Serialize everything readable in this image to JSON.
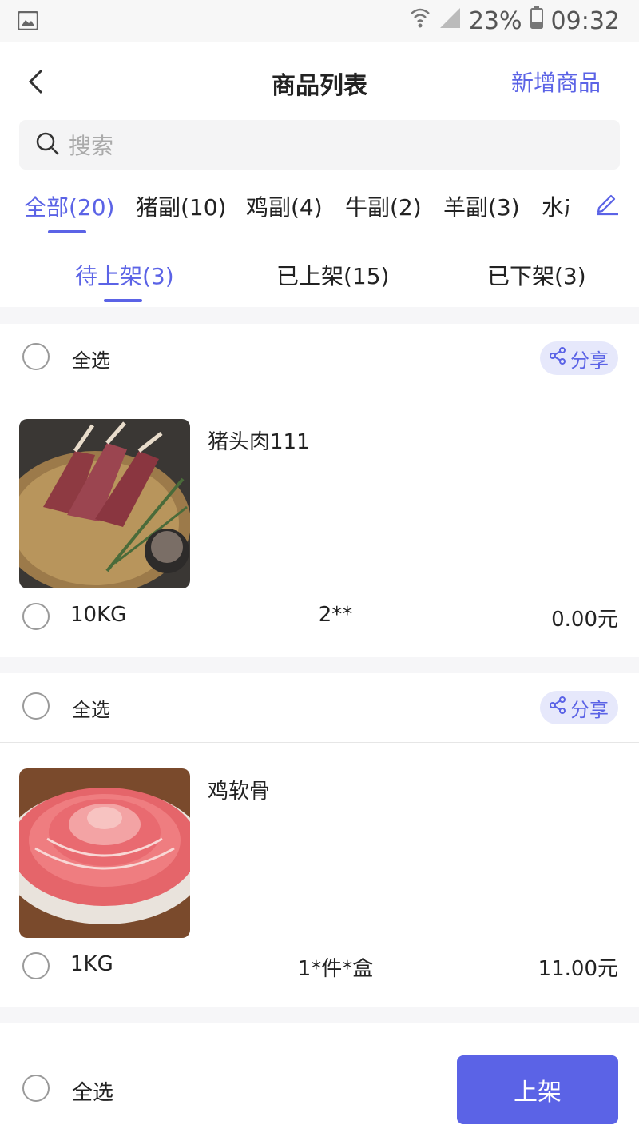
{
  "status_bar": {
    "battery": "23%",
    "time": "09:32"
  },
  "nav": {
    "title": "商品列表",
    "add_label": "新增商品"
  },
  "search": {
    "placeholder": "搜索"
  },
  "categories": [
    {
      "label": "全部(20)",
      "active": true
    },
    {
      "label": "猪副(10)"
    },
    {
      "label": "鸡副(4)"
    },
    {
      "label": "牛副(2)"
    },
    {
      "label": "羊副(3)"
    },
    {
      "label": "水产"
    }
  ],
  "status_tabs": [
    {
      "label": "待上架(3)",
      "active": true
    },
    {
      "label": "已上架(15)"
    },
    {
      "label": "已下架(3)"
    }
  ],
  "groups": [
    {
      "select_all_label": "全选",
      "share_label": "分享",
      "item": {
        "name": "猪头肉111",
        "weight": "10KG",
        "spec": "2**",
        "price": "0.00元",
        "image": "lamb-rack-photo"
      }
    },
    {
      "select_all_label": "全选",
      "share_label": "分享",
      "item": {
        "name": "鸡软骨",
        "weight": "1KG",
        "spec": "1*件*盒",
        "price": "11.00元",
        "image": "sliced-meat-photo"
      }
    }
  ],
  "bottom": {
    "select_all_label": "全选",
    "action_label": "上架"
  },
  "colors": {
    "accent": "#5b63e6",
    "share_bg": "#e6e8fb"
  }
}
